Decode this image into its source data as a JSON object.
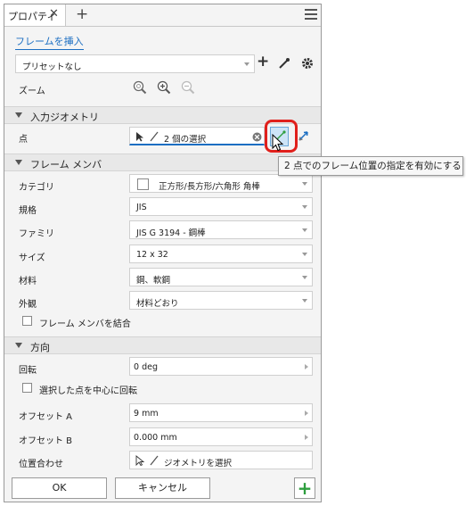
{
  "tab": {
    "title": "プロパティ",
    "close": "✕",
    "add": "+"
  },
  "insert_frame_link": "フレームを挿入",
  "preset": {
    "value": "プリセットなし"
  },
  "zoom": {
    "label": "ズーム"
  },
  "input_geometry": {
    "section_title": "入力ジオメトリ",
    "point_label": "点",
    "point_value": "2 個の選択",
    "tooltip": "2 点でのフレーム位置の指定を有効にする"
  },
  "frame_member": {
    "section_title": "フレーム メンバ",
    "rows": [
      {
        "label": "カテゴリ",
        "value": "正方形/長方形/六角形 角棒"
      },
      {
        "label": "規格",
        "value": "JIS"
      },
      {
        "label": "ファミリ",
        "value": "JIS G 3194 - 鋼棒"
      },
      {
        "label": "サイズ",
        "value": "12 x 32"
      },
      {
        "label": "材料",
        "value": "鋼、軟鋼"
      },
      {
        "label": "外観",
        "value": "材料どおり"
      }
    ],
    "combine_label": "フレーム メンバを結合"
  },
  "orientation": {
    "section_title": "方向",
    "rotation_label": "回転",
    "rotation_value": "0 deg",
    "rotate_center_label": "選択した点を中心に回転",
    "offset_a_label": "オフセット A",
    "offset_a_value": "9 mm",
    "offset_b_label": "オフセット B",
    "offset_b_value": "0.000 mm",
    "align_label": "位置合わせ",
    "align_value": "ジオメトリを選択"
  },
  "footer": {
    "ok": "OK",
    "cancel": "キャンセル",
    "apply": "+"
  },
  "colors": {
    "accent": "#1b6ec2",
    "highlight": "#e0201c",
    "apply_green": "#2e9e3e"
  }
}
